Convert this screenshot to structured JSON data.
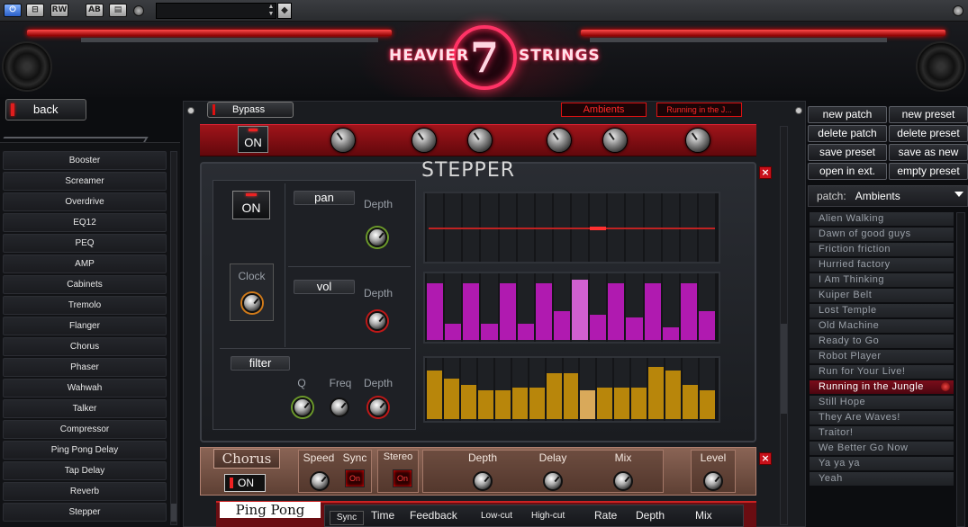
{
  "host": {
    "power_label": "⏻",
    "compare_label": "⊟",
    "rw_label": "RW",
    "ab_label": "AB",
    "menu_label": "▤",
    "preset_value": ""
  },
  "header": {
    "logo_left": "HEAVIER",
    "logo_center": "7",
    "logo_right": "STRINGS"
  },
  "sidebar": {
    "back_label": "back",
    "items": [
      "Booster",
      "Screamer",
      "Overdrive",
      "EQ12",
      "PEQ",
      "AMP",
      "Cabinets",
      "Tremolo",
      "Flanger",
      "Chorus",
      "Phaser",
      "Wahwah",
      "Talker",
      "Compressor",
      "Ping Pong Delay",
      "Tap Delay",
      "Reverb",
      "Stepper"
    ]
  },
  "center": {
    "bypass_label": "Bypass",
    "category_display": "Ambients",
    "patch_display": "Running in the J...",
    "top_on_label": "ON",
    "stepper": {
      "title": "STEPPER",
      "on_label": "ON",
      "clock_label": "Clock",
      "pan_label": "pan",
      "vol_label": "vol",
      "filter_label": "filter",
      "depth_label": "Depth",
      "q_label": "Q",
      "freq_label": "Freq",
      "pan_step": 9,
      "vol_levels": [
        0.9,
        0.25,
        0.9,
        0.25,
        0.9,
        0.25,
        0.9,
        0.45,
        0.95,
        0.4,
        0.9,
        0.35,
        0.9,
        0.2,
        0.9,
        0.45
      ],
      "vol_highlight": 8,
      "filter_levels": [
        0.85,
        0.7,
        0.6,
        0.5,
        0.5,
        0.55,
        0.55,
        0.8,
        0.8,
        0.5,
        0.55,
        0.55,
        0.55,
        0.9,
        0.85,
        0.6,
        0.5
      ],
      "filter_highlight": 9
    },
    "chorus": {
      "title": "Chorus",
      "on_label": "ON",
      "speed_label": "Speed",
      "sync_label": "Sync",
      "sync_state": "On",
      "stereo_label": "Stereo",
      "stereo_state": "On",
      "depth_label": "Depth",
      "delay_label": "Delay",
      "mix_label": "Mix",
      "level_label": "Level"
    },
    "pingpong": {
      "title": "Ping Pong",
      "sync_label": "Sync",
      "time_label": "Time",
      "feedback_label": "Feedback",
      "lowcut_label": "Low-cut",
      "highcut_label": "High-cut",
      "rate_label": "Rate",
      "depth_label": "Depth",
      "mix_label": "Mix"
    },
    "close_label": "×"
  },
  "right": {
    "buttons": [
      "new patch",
      "new preset",
      "delete patch",
      "delete preset",
      "save preset",
      "save as new",
      "open in ext.",
      "empty preset"
    ],
    "patch_prefix": "patch:",
    "patch_value": "Ambients",
    "presets": [
      "Alien Walking",
      "Dawn of good guys",
      "Friction friction",
      "Hurried factory",
      "I Am Thinking",
      "Kuiper Belt",
      "Lost Temple",
      "Old Machine",
      "Ready to Go",
      "Robot Player",
      "Run for Your Live!",
      "Running in the Jungle",
      "Still Hope",
      "They Are Waves!",
      "Traitor!",
      "We Better Go Now",
      "Ya ya ya",
      "Yeah"
    ],
    "selected_index": 11
  },
  "colors": {
    "accent_red": "#c8101a",
    "vol_bar": "#b01ab0",
    "vol_highlight": "#d060d0",
    "filter_bar": "#b8860b",
    "filter_highlight": "#d9a95a",
    "chorus_panel": "#7a5446"
  }
}
